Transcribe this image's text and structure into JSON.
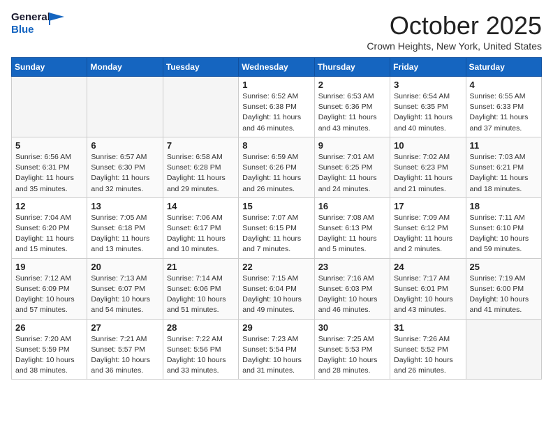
{
  "header": {
    "logo_general": "General",
    "logo_blue": "Blue",
    "month_title": "October 2025",
    "subtitle": "Crown Heights, New York, United States"
  },
  "days_of_week": [
    "Sunday",
    "Monday",
    "Tuesday",
    "Wednesday",
    "Thursday",
    "Friday",
    "Saturday"
  ],
  "weeks": [
    [
      {
        "day": "",
        "info": ""
      },
      {
        "day": "",
        "info": ""
      },
      {
        "day": "",
        "info": ""
      },
      {
        "day": "1",
        "info": "Sunrise: 6:52 AM\nSunset: 6:38 PM\nDaylight: 11 hours\nand 46 minutes."
      },
      {
        "day": "2",
        "info": "Sunrise: 6:53 AM\nSunset: 6:36 PM\nDaylight: 11 hours\nand 43 minutes."
      },
      {
        "day": "3",
        "info": "Sunrise: 6:54 AM\nSunset: 6:35 PM\nDaylight: 11 hours\nand 40 minutes."
      },
      {
        "day": "4",
        "info": "Sunrise: 6:55 AM\nSunset: 6:33 PM\nDaylight: 11 hours\nand 37 minutes."
      }
    ],
    [
      {
        "day": "5",
        "info": "Sunrise: 6:56 AM\nSunset: 6:31 PM\nDaylight: 11 hours\nand 35 minutes."
      },
      {
        "day": "6",
        "info": "Sunrise: 6:57 AM\nSunset: 6:30 PM\nDaylight: 11 hours\nand 32 minutes."
      },
      {
        "day": "7",
        "info": "Sunrise: 6:58 AM\nSunset: 6:28 PM\nDaylight: 11 hours\nand 29 minutes."
      },
      {
        "day": "8",
        "info": "Sunrise: 6:59 AM\nSunset: 6:26 PM\nDaylight: 11 hours\nand 26 minutes."
      },
      {
        "day": "9",
        "info": "Sunrise: 7:01 AM\nSunset: 6:25 PM\nDaylight: 11 hours\nand 24 minutes."
      },
      {
        "day": "10",
        "info": "Sunrise: 7:02 AM\nSunset: 6:23 PM\nDaylight: 11 hours\nand 21 minutes."
      },
      {
        "day": "11",
        "info": "Sunrise: 7:03 AM\nSunset: 6:21 PM\nDaylight: 11 hours\nand 18 minutes."
      }
    ],
    [
      {
        "day": "12",
        "info": "Sunrise: 7:04 AM\nSunset: 6:20 PM\nDaylight: 11 hours\nand 15 minutes."
      },
      {
        "day": "13",
        "info": "Sunrise: 7:05 AM\nSunset: 6:18 PM\nDaylight: 11 hours\nand 13 minutes."
      },
      {
        "day": "14",
        "info": "Sunrise: 7:06 AM\nSunset: 6:17 PM\nDaylight: 11 hours\nand 10 minutes."
      },
      {
        "day": "15",
        "info": "Sunrise: 7:07 AM\nSunset: 6:15 PM\nDaylight: 11 hours\nand 7 minutes."
      },
      {
        "day": "16",
        "info": "Sunrise: 7:08 AM\nSunset: 6:13 PM\nDaylight: 11 hours\nand 5 minutes."
      },
      {
        "day": "17",
        "info": "Sunrise: 7:09 AM\nSunset: 6:12 PM\nDaylight: 11 hours\nand 2 minutes."
      },
      {
        "day": "18",
        "info": "Sunrise: 7:11 AM\nSunset: 6:10 PM\nDaylight: 10 hours\nand 59 minutes."
      }
    ],
    [
      {
        "day": "19",
        "info": "Sunrise: 7:12 AM\nSunset: 6:09 PM\nDaylight: 10 hours\nand 57 minutes."
      },
      {
        "day": "20",
        "info": "Sunrise: 7:13 AM\nSunset: 6:07 PM\nDaylight: 10 hours\nand 54 minutes."
      },
      {
        "day": "21",
        "info": "Sunrise: 7:14 AM\nSunset: 6:06 PM\nDaylight: 10 hours\nand 51 minutes."
      },
      {
        "day": "22",
        "info": "Sunrise: 7:15 AM\nSunset: 6:04 PM\nDaylight: 10 hours\nand 49 minutes."
      },
      {
        "day": "23",
        "info": "Sunrise: 7:16 AM\nSunset: 6:03 PM\nDaylight: 10 hours\nand 46 minutes."
      },
      {
        "day": "24",
        "info": "Sunrise: 7:17 AM\nSunset: 6:01 PM\nDaylight: 10 hours\nand 43 minutes."
      },
      {
        "day": "25",
        "info": "Sunrise: 7:19 AM\nSunset: 6:00 PM\nDaylight: 10 hours\nand 41 minutes."
      }
    ],
    [
      {
        "day": "26",
        "info": "Sunrise: 7:20 AM\nSunset: 5:59 PM\nDaylight: 10 hours\nand 38 minutes."
      },
      {
        "day": "27",
        "info": "Sunrise: 7:21 AM\nSunset: 5:57 PM\nDaylight: 10 hours\nand 36 minutes."
      },
      {
        "day": "28",
        "info": "Sunrise: 7:22 AM\nSunset: 5:56 PM\nDaylight: 10 hours\nand 33 minutes."
      },
      {
        "day": "29",
        "info": "Sunrise: 7:23 AM\nSunset: 5:54 PM\nDaylight: 10 hours\nand 31 minutes."
      },
      {
        "day": "30",
        "info": "Sunrise: 7:25 AM\nSunset: 5:53 PM\nDaylight: 10 hours\nand 28 minutes."
      },
      {
        "day": "31",
        "info": "Sunrise: 7:26 AM\nSunset: 5:52 PM\nDaylight: 10 hours\nand 26 minutes."
      },
      {
        "day": "",
        "info": ""
      }
    ]
  ]
}
